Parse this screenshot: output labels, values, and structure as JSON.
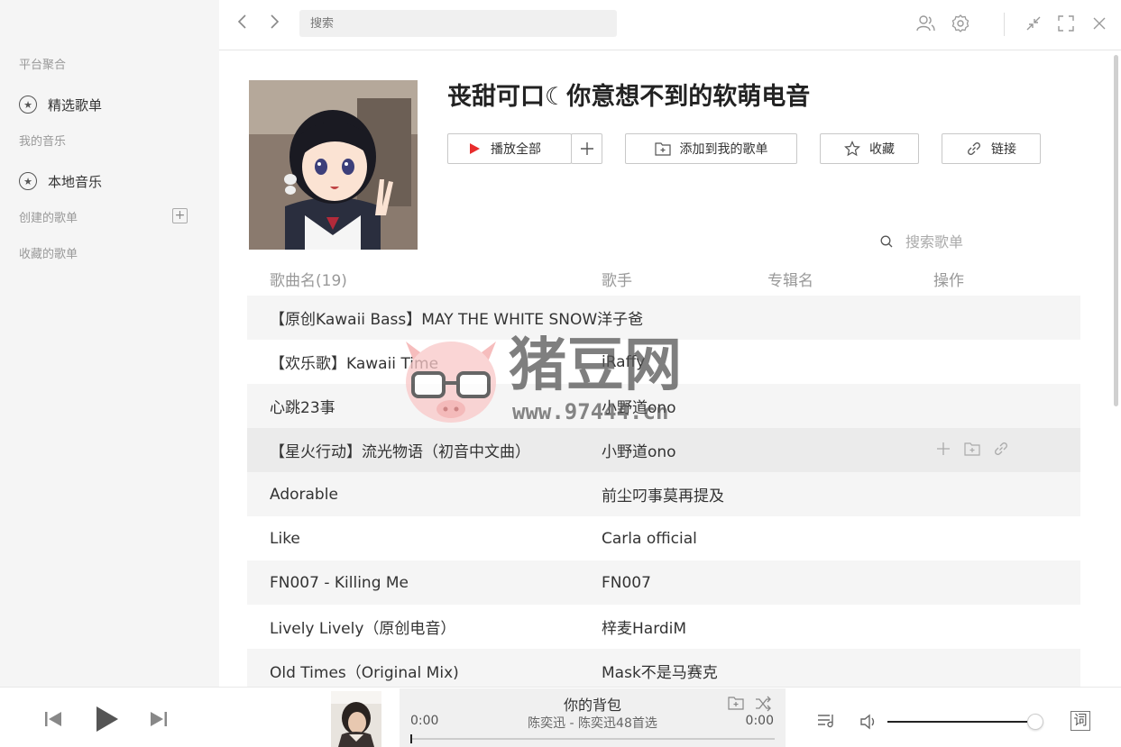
{
  "sidebar": {
    "section_platform": "平台聚合",
    "featured_playlists": "精选歌单",
    "section_my_music": "我的音乐",
    "local_music": "本地音乐",
    "section_created": "创建的歌单",
    "section_collected": "收藏的歌单"
  },
  "topbar": {
    "search_placeholder": "搜索"
  },
  "playlist": {
    "title": "丧甜可口☾你意想不到的软萌电音",
    "play_all": "播放全部",
    "add_to_my": "添加到我的歌单",
    "collect": "收藏",
    "link": "链接",
    "search_placeholder": "搜索歌单"
  },
  "table": {
    "headers": {
      "name": "歌曲名(19)",
      "artist": "歌手",
      "album": "专辑名",
      "actions": "操作"
    },
    "rows": [
      {
        "name": "【原创Kawaii Bass】MAY THE WHITE SNOW洋子爸",
        "artist": ""
      },
      {
        "name": "【欢乐歌】Kawaii Time",
        "artist": "iRaffy"
      },
      {
        "name": "心跳23事",
        "artist": "小野道ono"
      },
      {
        "name": "【星火行动】流光物语（初音中文曲）",
        "artist": "小野道ono"
      },
      {
        "name": "Adorable",
        "artist": "前尘叼事莫再提及"
      },
      {
        "name": "Like",
        "artist": "Carla  official"
      },
      {
        "name": "FN007 - Killing Me",
        "artist": "FN007"
      },
      {
        "name": "Lively Lively（原创电音）",
        "artist": "梓麦HardiM"
      },
      {
        "name": "Old Times（Original Mix)",
        "artist": "Mask不是马赛克"
      }
    ]
  },
  "watermark": {
    "text": "猪豆网",
    "url": "www.97444.cn"
  },
  "player": {
    "title": "你的背包",
    "subtitle": "陈奕迅 - 陈奕迅48首选",
    "current_time": "0:00",
    "total_time": "0:00",
    "progress": 0,
    "volume": 0.94,
    "lyric_label": "词"
  },
  "icons": {
    "back": "chevron-left-icon",
    "forward": "chevron-right-icon",
    "user": "user-icon",
    "settings": "gear-icon",
    "minimize": "minimize-icon",
    "fullscreen": "fullscreen-icon",
    "close": "close-icon"
  }
}
